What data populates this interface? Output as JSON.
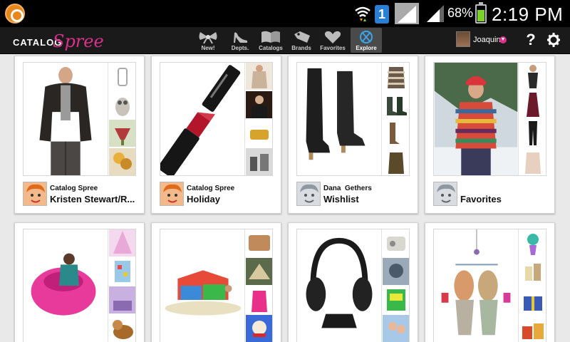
{
  "status_bar": {
    "notification_count": "1",
    "battery_percent": "68%",
    "battery_level": 0.68,
    "time": "2:19 PM"
  },
  "app": {
    "logo_catalog": "CATALOG",
    "logo_spree": "Spree",
    "brand_color": "#d9318c"
  },
  "nav": {
    "items": [
      {
        "label": "New!",
        "icon": "bow-icon",
        "active": false
      },
      {
        "label": "Depts.",
        "icon": "high-heel-icon",
        "active": false
      },
      {
        "label": "Catalogs",
        "icon": "open-book-icon",
        "active": false
      },
      {
        "label": "Brands",
        "icon": "tag-icon",
        "active": false
      },
      {
        "label": "Favorites",
        "icon": "heart-icon",
        "active": false
      },
      {
        "label": "Explore",
        "icon": "compass-icon",
        "active": true
      }
    ]
  },
  "user": {
    "name": "Joaquin"
  },
  "catalogs": [
    {
      "owner": "Catalog Spree",
      "title": "Kristen Stewart/R..."
    },
    {
      "owner": "Catalog Spree",
      "title": "Holiday"
    },
    {
      "owner": "Dana  Gethers",
      "title": "Wishlist"
    },
    {
      "owner": "",
      "title": "Favorites"
    },
    {
      "owner": "",
      "title": ""
    },
    {
      "owner": "",
      "title": ""
    },
    {
      "owner": "",
      "title": ""
    },
    {
      "owner": "",
      "title": ""
    }
  ]
}
